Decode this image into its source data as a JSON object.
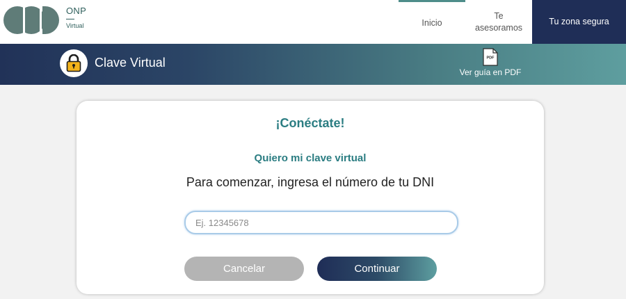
{
  "brand": {
    "name": "ONP",
    "subtitle": "Virtual",
    "logo_icon": "onp-logo-icon",
    "color": "#2f5f5c"
  },
  "nav": {
    "inicio": "Inicio",
    "asesoramos": "Te asesoramos",
    "zona_segura": "Tu zona segura"
  },
  "banner": {
    "title": "Clave Virtual",
    "lock_icon": "padlock-icon",
    "pdf_icon": "pdf-document-icon",
    "pdf_icon_text": "PDF",
    "pdf_label": "Ver guía en PDF"
  },
  "form": {
    "heading": "¡Conéctate!",
    "subheading": "Quiero mi clave virtual",
    "instruction": "Para comenzar, ingresa el número de tu DNI",
    "dni_value": "",
    "dni_placeholder": "Ej. 12345678",
    "cancel_label": "Cancelar",
    "continue_label": "Continuar"
  },
  "colors": {
    "navy": "#1f2e57",
    "teal": "#2b7d82",
    "teal_light": "#5e9e9f",
    "cancel_gray": "#b4b4b4"
  }
}
